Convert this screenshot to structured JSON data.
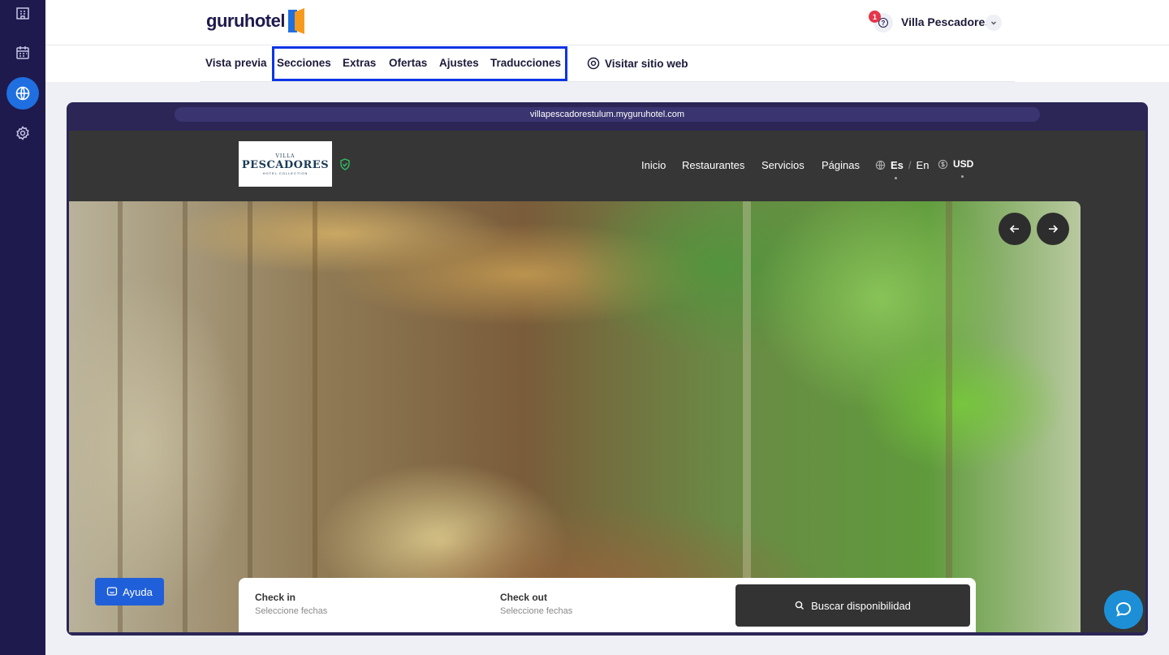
{
  "sidebar": {
    "items": [
      {
        "icon": "building-icon",
        "active": false
      },
      {
        "icon": "calendar-icon",
        "active": false
      },
      {
        "icon": "globe-icon",
        "active": true
      },
      {
        "icon": "gear-icon",
        "active": false
      }
    ]
  },
  "header": {
    "brand": "guruhotel",
    "notification_count": "1",
    "help_glyph": "?",
    "hotel_name": "Villa Pescadores"
  },
  "subnav": {
    "tabs": [
      "Vista previa",
      "Secciones",
      "Extras",
      "Ofertas",
      "Ajustes",
      "Traducciones"
    ],
    "visit_label": "Visitar sitio web"
  },
  "preview": {
    "url": "villapescadorestulum.myguruhotel.com",
    "logo": {
      "small": "VILLA",
      "big": "PESCADORES",
      "tiny": "HOTEL COLLECTION"
    },
    "nav": [
      "Inicio",
      "Restaurantes",
      "Servicios",
      "Páginas"
    ],
    "lang_active": "Es",
    "lang_sep": "/",
    "lang_other": "En",
    "currency": "USD",
    "booking": {
      "checkin_label": "Check in",
      "checkin_placeholder": "Seleccione fechas",
      "checkout_label": "Check out",
      "checkout_placeholder": "Seleccione fechas",
      "search_label": "Buscar disponibilidad"
    }
  },
  "help_button": "Ayuda",
  "colors": {
    "rail": "#1e1a4d",
    "accent": "#1f6fe0",
    "highlight": "#0c34e6",
    "frame": "#2b2656"
  }
}
